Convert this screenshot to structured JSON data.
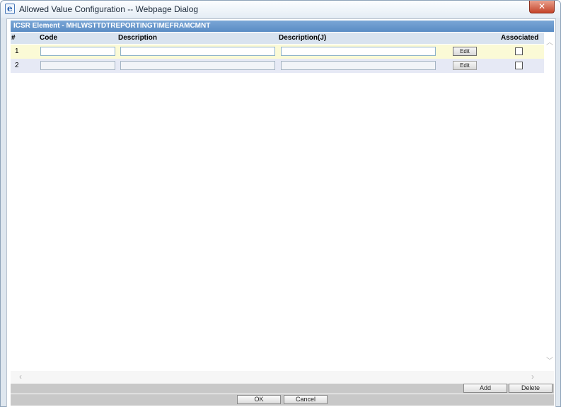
{
  "window": {
    "title": "Allowed Value Configuration -- Webpage Dialog",
    "close_glyph": "✕"
  },
  "header": {
    "element_title": "ICSR Element - MHLWSTTDTREPORTINGTIMEFRAMCMNT"
  },
  "grid": {
    "columns": [
      "#",
      "Code",
      "Description",
      "Description(J)",
      "Associated"
    ],
    "rows": [
      {
        "num": "1",
        "code": "",
        "description": "",
        "description_j": "",
        "edit_label": "Edit",
        "associated": false
      },
      {
        "num": "2",
        "code": "",
        "description": "",
        "description_j": "",
        "edit_label": "Edit",
        "associated": false
      }
    ]
  },
  "scroll": {
    "up_glyph": "︿",
    "down_glyph": "﹀",
    "left_glyph": "‹",
    "right_glyph": "›"
  },
  "actions": {
    "add_label": "Add",
    "delete_label": "Delete"
  },
  "footer": {
    "ok_label": "OK",
    "cancel_label": "Cancel"
  }
}
